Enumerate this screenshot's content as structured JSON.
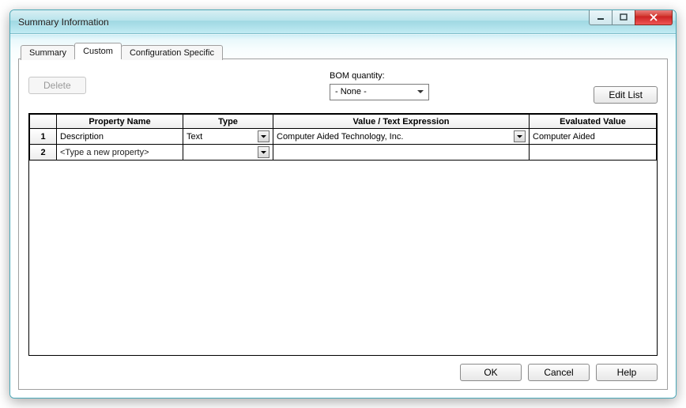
{
  "window": {
    "title": "Summary Information"
  },
  "tabs": {
    "summary": "Summary",
    "custom": "Custom",
    "config": "Configuration Specific",
    "active": "custom"
  },
  "buttons": {
    "delete": "Delete",
    "edit_list": "Edit List",
    "ok": "OK",
    "cancel": "Cancel",
    "help": "Help"
  },
  "bom": {
    "label": "BOM quantity:",
    "value": "- None -"
  },
  "grid": {
    "headers": {
      "property_name": "Property Name",
      "type": "Type",
      "value": "Value / Text Expression",
      "evaluated": "Evaluated Value"
    },
    "rows": [
      {
        "num": "1",
        "name": "Description",
        "type": "Text",
        "value": "Computer Aided Technology, Inc.",
        "evaluated": "Computer Aided"
      },
      {
        "num": "2",
        "name": "<Type a new property>",
        "type": "",
        "value": "",
        "evaluated": ""
      }
    ]
  }
}
